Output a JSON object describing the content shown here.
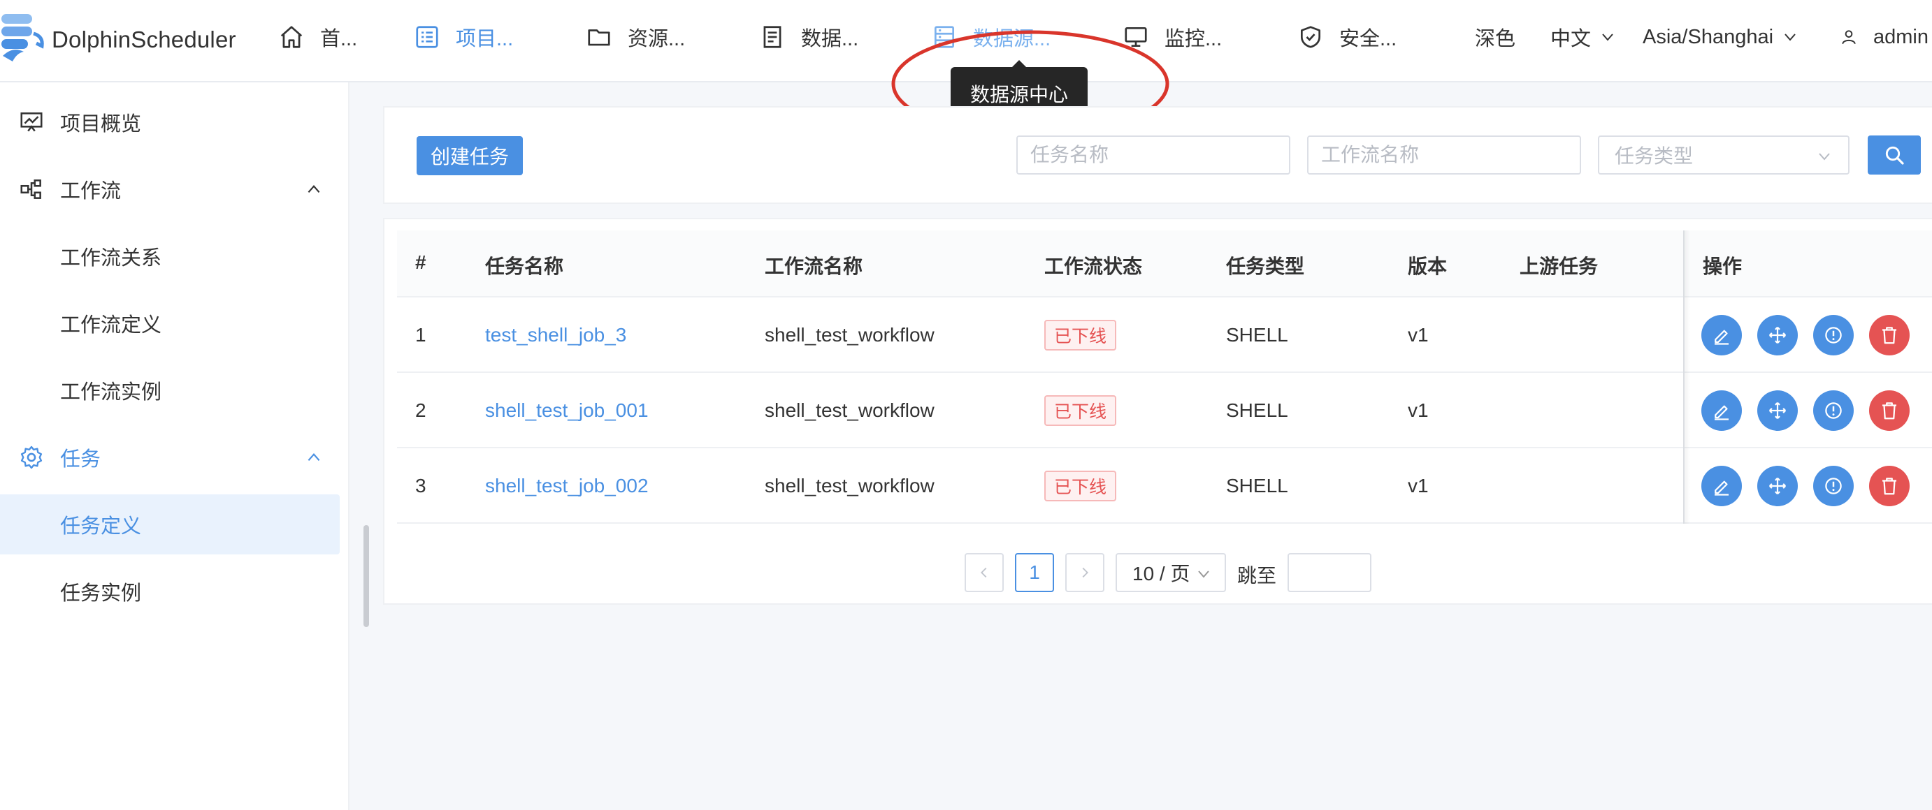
{
  "app": {
    "name": "DolphinScheduler"
  },
  "nav": {
    "items": [
      {
        "label": "首...",
        "icon": "home-icon"
      },
      {
        "label": "项目...",
        "icon": "project-icon"
      },
      {
        "label": "资源...",
        "icon": "folder-icon"
      },
      {
        "label": "数据...",
        "icon": "data-quality-icon"
      },
      {
        "label": "数据源...",
        "icon": "datasource-icon"
      },
      {
        "label": "监控...",
        "icon": "monitor-icon"
      },
      {
        "label": "安全...",
        "icon": "shield-icon"
      }
    ],
    "active_index": 1,
    "hovered_index": 4,
    "tooltip": "数据源中心"
  },
  "header_right": {
    "theme": "深色",
    "language": "中文",
    "timezone": "Asia/Shanghai",
    "user": "admin"
  },
  "sidebar": {
    "items": [
      {
        "label": "项目概览",
        "icon": "overview-icon",
        "level": 1
      },
      {
        "label": "工作流",
        "icon": "workflow-icon",
        "level": 1,
        "expanded": true
      },
      {
        "label": "工作流关系",
        "level": 2
      },
      {
        "label": "工作流定义",
        "level": 2
      },
      {
        "label": "工作流实例",
        "level": 2
      },
      {
        "label": "任务",
        "icon": "gear-icon",
        "level": 1,
        "expanded": true
      },
      {
        "label": "任务定义",
        "level": 2,
        "selected": true
      },
      {
        "label": "任务实例",
        "level": 2
      }
    ]
  },
  "toolbar": {
    "create_label": "创建任务",
    "task_name_placeholder": "任务名称",
    "workflow_name_placeholder": "工作流名称",
    "task_type_placeholder": "任务类型"
  },
  "table": {
    "headers": [
      "#",
      "任务名称",
      "工作流名称",
      "工作流状态",
      "任务类型",
      "版本",
      "上游任务",
      "操作"
    ],
    "rows": [
      {
        "index": "1",
        "task_name": "test_shell_job_3",
        "workflow_name": "shell_test_workflow",
        "status": "已下线",
        "task_type": "SHELL",
        "version": "v1",
        "upstream": ""
      },
      {
        "index": "2",
        "task_name": "shell_test_job_001",
        "workflow_name": "shell_test_workflow",
        "status": "已下线",
        "task_type": "SHELL",
        "version": "v1",
        "upstream": ""
      },
      {
        "index": "3",
        "task_name": "shell_test_job_002",
        "workflow_name": "shell_test_workflow",
        "status": "已下线",
        "task_type": "SHELL",
        "version": "v1",
        "upstream": ""
      }
    ]
  },
  "pagination": {
    "current_page": "1",
    "page_size": "10 / 页",
    "jump_label": "跳至",
    "jump_value": ""
  },
  "colors": {
    "primary": "#4a90e2",
    "danger": "#e55353",
    "annotation": "#d9352b"
  }
}
